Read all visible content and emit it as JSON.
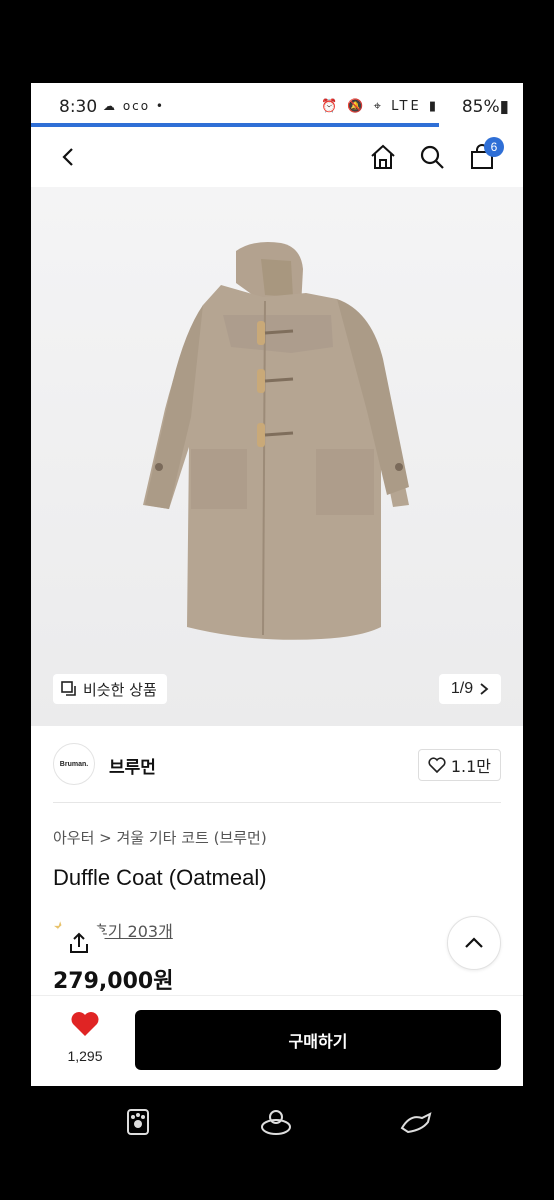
{
  "status": {
    "time": "8:30",
    "left_icons": "☁ oco •",
    "right_icons": "⏰ 🔕 ⌖ LTE ▮",
    "battery": "85%▮"
  },
  "header": {
    "cart_count": "6"
  },
  "gallery": {
    "similar_label": "비슷한 상품",
    "counter": "1/9"
  },
  "brand": {
    "logo_text": "Bruman.",
    "name": "브루먼",
    "likes": "1.1만"
  },
  "product": {
    "category": "아우터 > 겨울 기타 코트 (브루먼)",
    "title": "Duffle Coat (Oatmeal)",
    "stars": "★",
    "review_label": "후기 203개",
    "price": "279,000원"
  },
  "bottom": {
    "wish_count": "1,295",
    "buy_label": "구매하기"
  },
  "colors": {
    "accent": "#2f6fd6",
    "coat": "#b5a592",
    "heart": "#e02424"
  }
}
